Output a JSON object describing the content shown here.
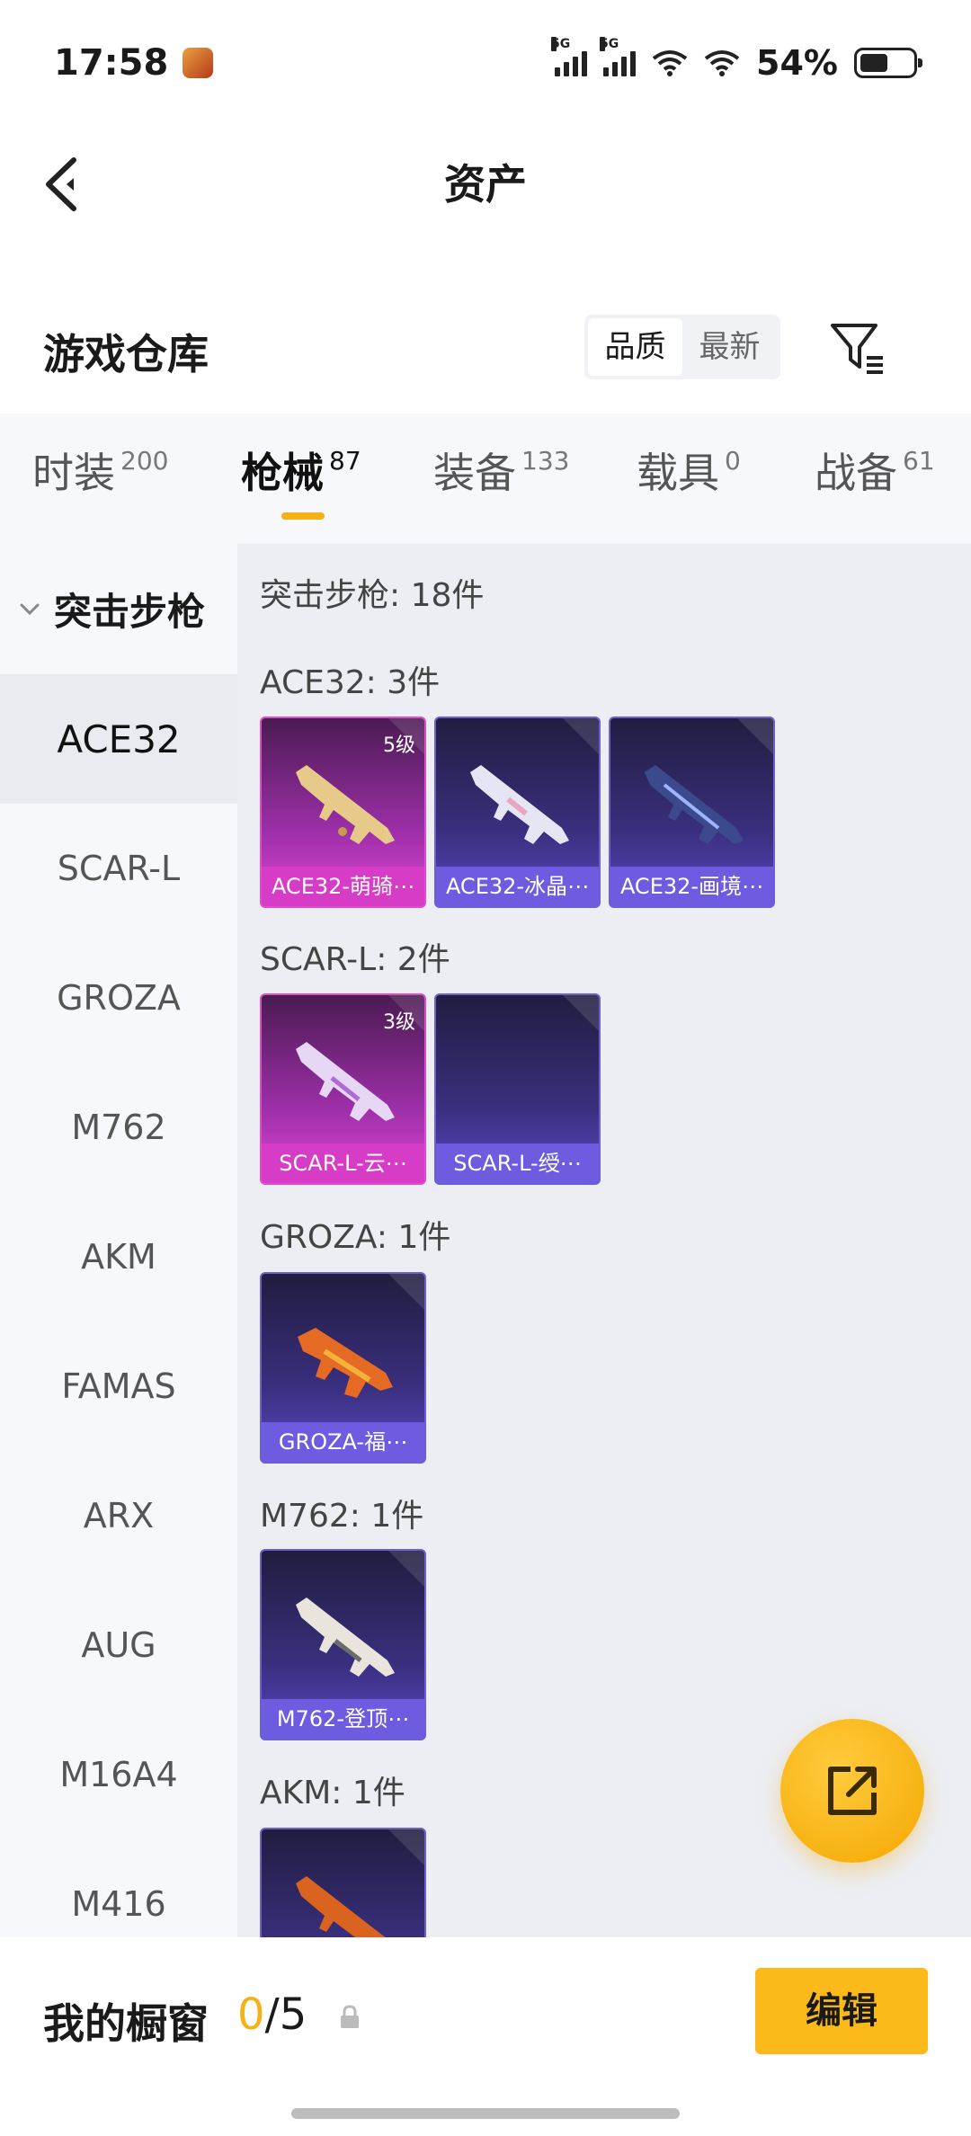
{
  "status_bar": {
    "time": "17:58",
    "battery": "54%",
    "signal_tag": "5G"
  },
  "header": {
    "title": "资产"
  },
  "warehouse": {
    "title": "游戏仓库",
    "sort_options": [
      "品质",
      "最新"
    ],
    "sort_selected": "品质"
  },
  "tabs": [
    {
      "label": "时装",
      "count": "200"
    },
    {
      "label": "枪械",
      "count": "87"
    },
    {
      "label": "装备",
      "count": "133"
    },
    {
      "label": "载具",
      "count": "0"
    },
    {
      "label": "战备",
      "count": "61"
    }
  ],
  "sidebar": {
    "group": "突击步枪",
    "items": [
      "ACE32",
      "SCAR-L",
      "GROZA",
      "M762",
      "AKM",
      "FAMAS",
      "ARX",
      "AUG",
      "M16A4",
      "M416"
    ],
    "selected": "ACE32"
  },
  "content": {
    "summary": "突击步枪: 18件",
    "sections": [
      {
        "title": "ACE32: 3件",
        "cards": [
          {
            "name": "ACE32-萌骑⋯",
            "tier": "5级",
            "rarity": "pink"
          },
          {
            "name": "ACE32-冰晶⋯",
            "tier": "",
            "rarity": "purple"
          },
          {
            "name": "ACE32-画境⋯",
            "tier": "",
            "rarity": "purple"
          }
        ]
      },
      {
        "title": "SCAR-L: 2件",
        "cards": [
          {
            "name": "SCAR-L-云⋯",
            "tier": "3级",
            "rarity": "pink"
          },
          {
            "name": "SCAR-L-绶⋯",
            "tier": "",
            "rarity": "purple"
          }
        ]
      },
      {
        "title": "GROZA: 1件",
        "cards": [
          {
            "name": "GROZA-福⋯",
            "tier": "",
            "rarity": "purple"
          }
        ]
      },
      {
        "title": "M762: 1件",
        "cards": [
          {
            "name": "M762-登顶⋯",
            "tier": "",
            "rarity": "purple"
          }
        ]
      },
      {
        "title": "AKM: 1件",
        "cards": [
          {
            "name": "",
            "tier": "",
            "rarity": "purple"
          }
        ]
      }
    ]
  },
  "bottom_bar": {
    "label": "我的橱窗",
    "current": "0",
    "total": "/5",
    "edit_label": "编辑"
  },
  "colors": {
    "accent": "#fbb91a",
    "purple_card": "#6e5ce0",
    "pink_card": "#d63cc6"
  }
}
